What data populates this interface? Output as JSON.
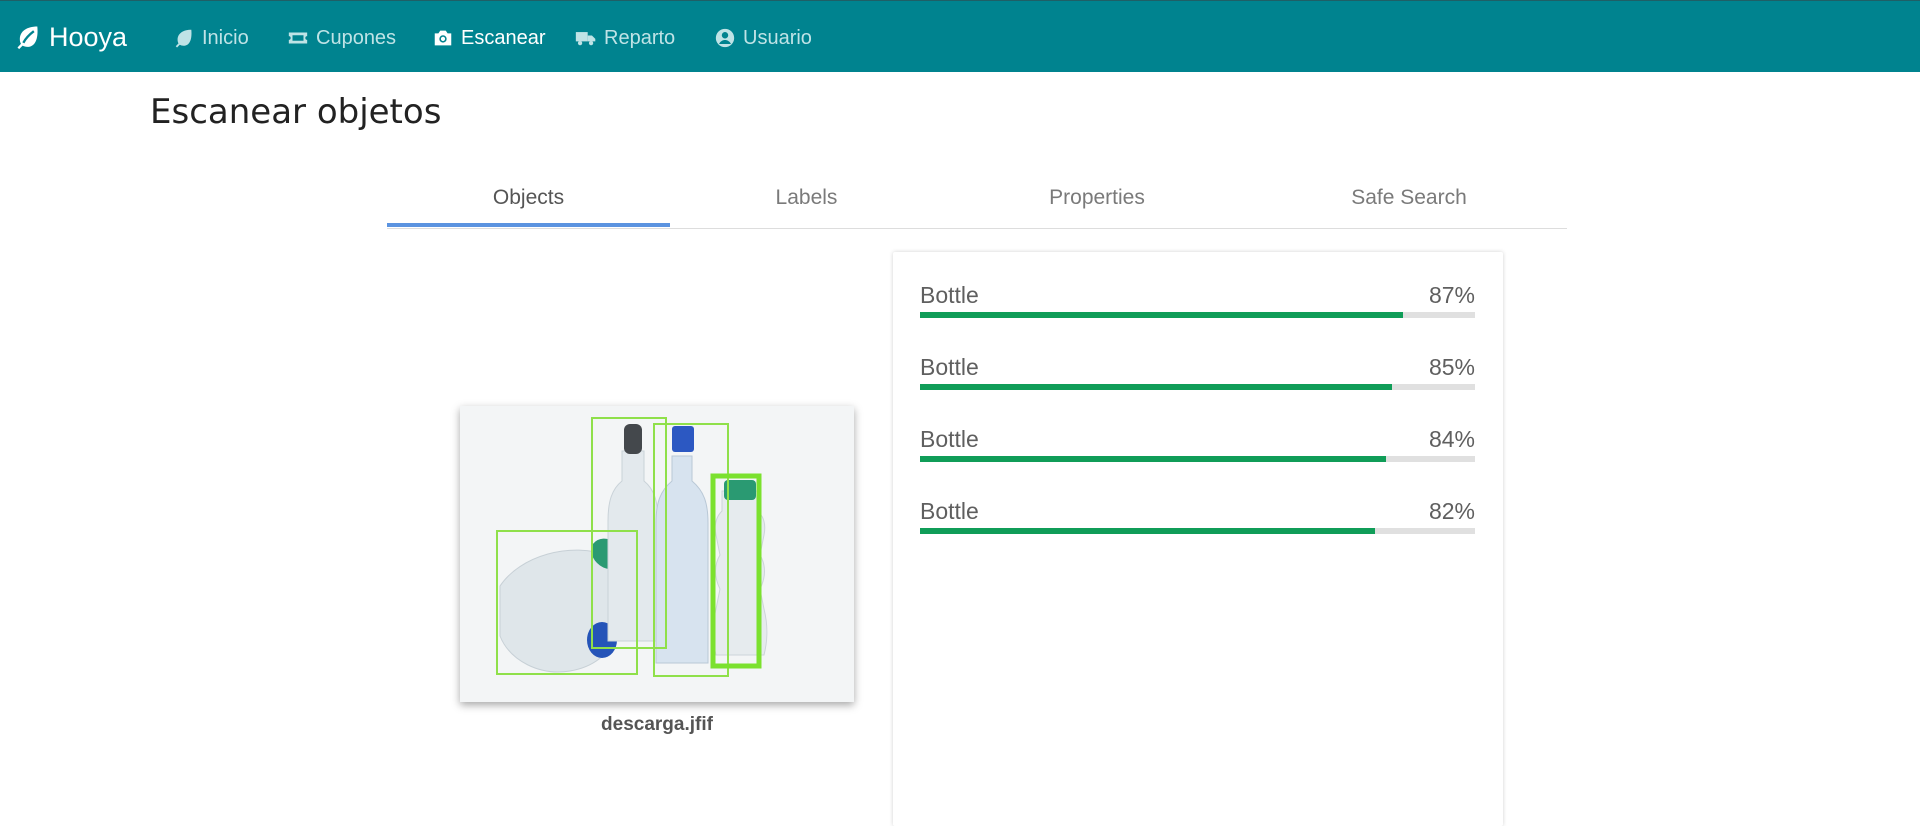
{
  "brand": {
    "name": "Hooya",
    "icon": "leaf-icon"
  },
  "nav": [
    {
      "label": "Inicio",
      "icon": "leaf-icon",
      "active": false
    },
    {
      "label": "Cupones",
      "icon": "ticket-icon",
      "active": false
    },
    {
      "label": "Escanear",
      "icon": "camera-icon",
      "active": true
    },
    {
      "label": "Reparto",
      "icon": "truck-icon",
      "active": false
    },
    {
      "label": "Usuario",
      "icon": "user-circle-icon",
      "active": false
    }
  ],
  "page": {
    "title": "Escanear objetos"
  },
  "tabs": [
    {
      "label": "Objects",
      "active": true
    },
    {
      "label": "Labels",
      "active": false
    },
    {
      "label": "Properties",
      "active": false
    },
    {
      "label": "Safe Search",
      "active": false
    }
  ],
  "image": {
    "filename": "descarga.jfif"
  },
  "results": [
    {
      "name": "Bottle",
      "percent": "87%",
      "value": 0.87
    },
    {
      "name": "Bottle",
      "percent": "85%",
      "value": 0.85
    },
    {
      "name": "Bottle",
      "percent": "84%",
      "value": 0.84
    },
    {
      "name": "Bottle",
      "percent": "82%",
      "value": 0.82
    }
  ],
  "colors": {
    "navbar": "#00838f",
    "accent": "#5b93e0",
    "bar_fill": "#109d58",
    "box_stroke": "#8fe04a"
  }
}
